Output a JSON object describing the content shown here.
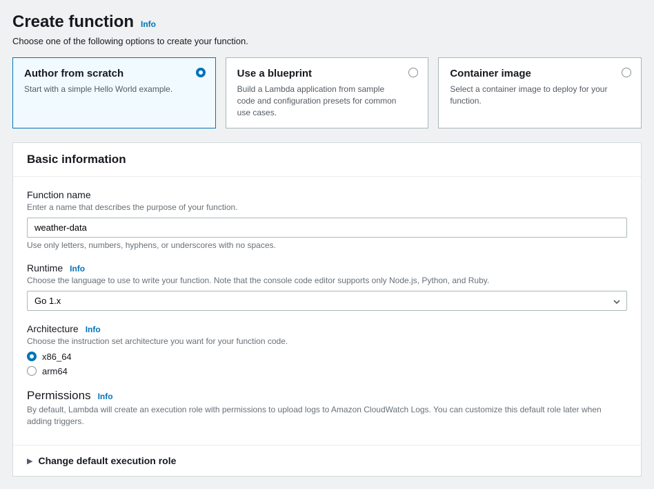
{
  "header": {
    "title": "Create function",
    "info": "Info",
    "subtitle": "Choose one of the following options to create your function."
  },
  "options": [
    {
      "title": "Author from scratch",
      "desc": "Start with a simple Hello World example.",
      "selected": true
    },
    {
      "title": "Use a blueprint",
      "desc": "Build a Lambda application from sample code and configuration presets for common use cases.",
      "selected": false
    },
    {
      "title": "Container image",
      "desc": "Select a container image to deploy for your function.",
      "selected": false
    }
  ],
  "basic": {
    "heading": "Basic information",
    "fn_name": {
      "label": "Function name",
      "help": "Enter a name that describes the purpose of your function.",
      "value": "weather-data",
      "hint": "Use only letters, numbers, hyphens, or underscores with no spaces."
    },
    "runtime": {
      "label": "Runtime",
      "info": "Info",
      "help": "Choose the language to use to write your function. Note that the console code editor supports only Node.js, Python, and Ruby.",
      "value": "Go 1.x"
    },
    "arch": {
      "label": "Architecture",
      "info": "Info",
      "help": "Choose the instruction set architecture you want for your function code.",
      "options": [
        {
          "label": "x86_64",
          "checked": true
        },
        {
          "label": "arm64",
          "checked": false
        }
      ]
    },
    "perms": {
      "label": "Permissions",
      "info": "Info",
      "help": "By default, Lambda will create an execution role with permissions to upload logs to Amazon CloudWatch Logs. You can customize this default role later when adding triggers."
    },
    "expander": "Change default execution role"
  }
}
